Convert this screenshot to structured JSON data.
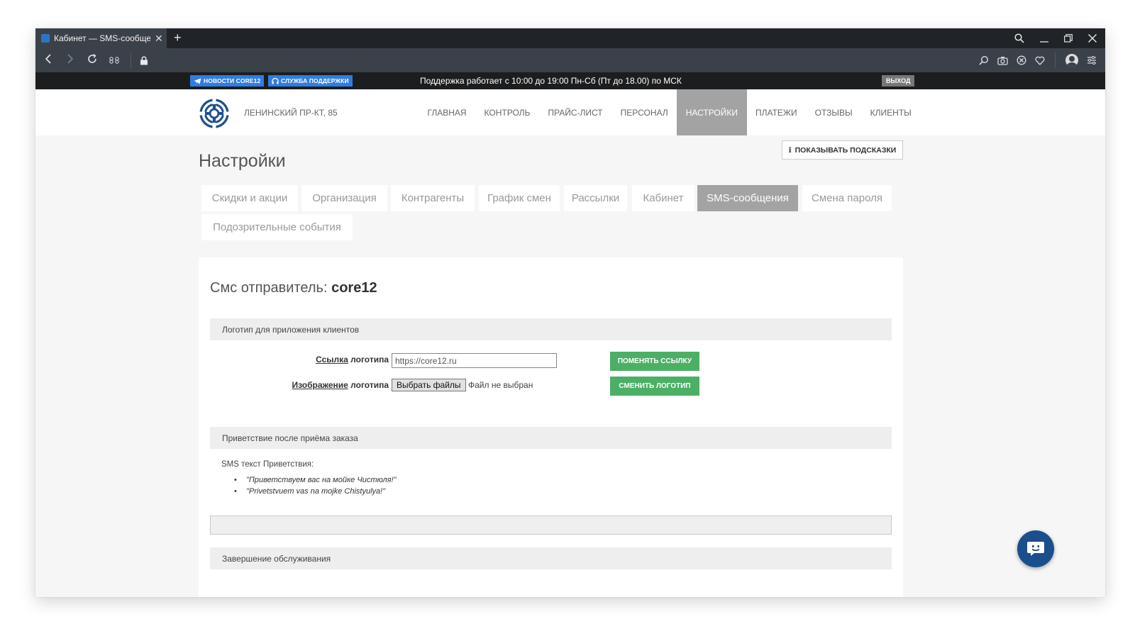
{
  "browser": {
    "tab_title": "Кабинет — SMS-сообщения",
    "new_tab": "+",
    "close_glyph": "✕"
  },
  "topbar": {
    "news_button": "НОВОСТИ CORE12",
    "support_button": "СЛУЖБА ПОДДЕРЖКИ",
    "support_hours": "Поддержка работает с 10:00 до 19:00 Пн-Сб (Пт до 18.00) по МСК",
    "exit_button": "ВЫХОД",
    "accent_color": "#2f7de1"
  },
  "header": {
    "address": "ЛЕНИНСКИЙ ПР-КТ, 85",
    "nav": [
      {
        "label": "ГЛАВНАЯ",
        "active": false
      },
      {
        "label": "КОНТРОЛЬ",
        "active": false
      },
      {
        "label": "ПРАЙС-ЛИСТ",
        "active": false
      },
      {
        "label": "ПЕРСОНАЛ",
        "active": false
      },
      {
        "label": "НАСТРОЙКИ",
        "active": true
      },
      {
        "label": "ПЛАТЕЖИ",
        "active": false
      },
      {
        "label": "ОТЗЫВЫ",
        "active": false
      },
      {
        "label": "КЛИЕНТЫ",
        "active": false
      }
    ]
  },
  "page": {
    "hint_button": "ПОКАЗЫВАТЬ ПОДСКАЗКИ",
    "title": "Настройки",
    "tabs": [
      {
        "label": "Скидки и акции",
        "active": false
      },
      {
        "label": "Организация",
        "active": false
      },
      {
        "label": "Контрагенты",
        "active": false
      },
      {
        "label": "График смен",
        "active": false
      },
      {
        "label": "Рассылки",
        "active": false
      },
      {
        "label": "Кабинет",
        "active": false
      },
      {
        "label": "SMS-сообщения",
        "active": true
      },
      {
        "label": "Смена пароля",
        "active": false
      },
      {
        "label": "Подозрительные события",
        "active": false
      }
    ]
  },
  "panel": {
    "sender_prefix": "Смс отправитель: ",
    "sender_name": "core12",
    "logo_section": {
      "heading": "Логотип для приложения клиентов",
      "link_label_ul": "Ссылка",
      "link_label_rest": " логотипа",
      "link_value": "https://core12.ru",
      "image_label_ul": "Изображение",
      "image_label_rest": " логотипа",
      "file_button": "Выбрать файлы",
      "file_status": "Файл не выбран",
      "change_link_button": "ПОМЕНЯТЬ ССЫЛКУ",
      "change_logo_button": "СМЕНИТЬ ЛОГОТИП",
      "button_color": "#4caf66"
    },
    "greeting_section": {
      "heading": "Приветствие после приёма заказа",
      "sms_label": "SMS текст Приветствия:",
      "messages": [
        "\"Приветствуем вас на мойке Чистюля!\"",
        "\"Privetstvuem vas na mojke Chistyulya!\""
      ]
    },
    "completion_section": {
      "heading": "Завершение обслуживания"
    }
  }
}
